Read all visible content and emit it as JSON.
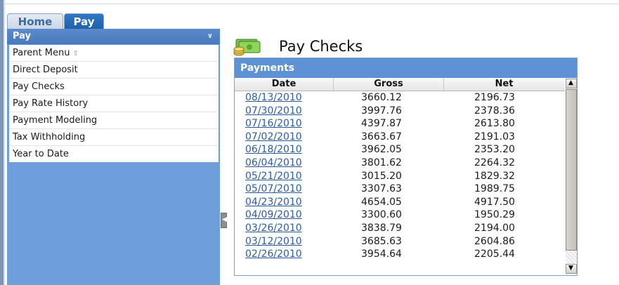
{
  "tabs": [
    {
      "label": "Home"
    },
    {
      "label": "Pay"
    }
  ],
  "sidebar": {
    "header": "Pay",
    "items": [
      {
        "label": "Parent Menu"
      },
      {
        "label": "Direct Deposit"
      },
      {
        "label": "Pay Checks"
      },
      {
        "label": "Pay Rate History"
      },
      {
        "label": "Payment Modeling"
      },
      {
        "label": "Tax Withholding"
      },
      {
        "label": "Year to Date"
      }
    ]
  },
  "page": {
    "title": "Pay Checks",
    "icon": "money-stack-icon"
  },
  "payments": {
    "header": "Payments",
    "columns": [
      "Date",
      "Gross",
      "Net"
    ],
    "rows": [
      {
        "date": "08/13/2010",
        "gross": "3660.12",
        "net": "2196.73"
      },
      {
        "date": "07/30/2010",
        "gross": "3997.76",
        "net": "2378.36"
      },
      {
        "date": "07/16/2010",
        "gross": "4397.87",
        "net": "2613.80"
      },
      {
        "date": "07/02/2010",
        "gross": "3663.67",
        "net": "2191.03"
      },
      {
        "date": "06/18/2010",
        "gross": "3962.05",
        "net": "2353.20"
      },
      {
        "date": "06/04/2010",
        "gross": "3801.62",
        "net": "2264.32"
      },
      {
        "date": "05/21/2010",
        "gross": "3015.20",
        "net": "1829.32"
      },
      {
        "date": "05/07/2010",
        "gross": "3307.63",
        "net": "1989.75"
      },
      {
        "date": "04/23/2010",
        "gross": "4654.05",
        "net": "4917.50"
      },
      {
        "date": "04/09/2010",
        "gross": "3300.60",
        "net": "1950.29"
      },
      {
        "date": "03/26/2010",
        "gross": "3838.79",
        "net": "2194.00"
      },
      {
        "date": "03/12/2010",
        "gross": "3685.63",
        "net": "2604.86"
      },
      {
        "date": "02/26/2010",
        "gross": "3954.64",
        "net": "2205.44"
      }
    ]
  },
  "colors": {
    "accent": "#5d92d4",
    "sidebar_bg": "#6f9fda",
    "link": "#2b5d9e"
  }
}
